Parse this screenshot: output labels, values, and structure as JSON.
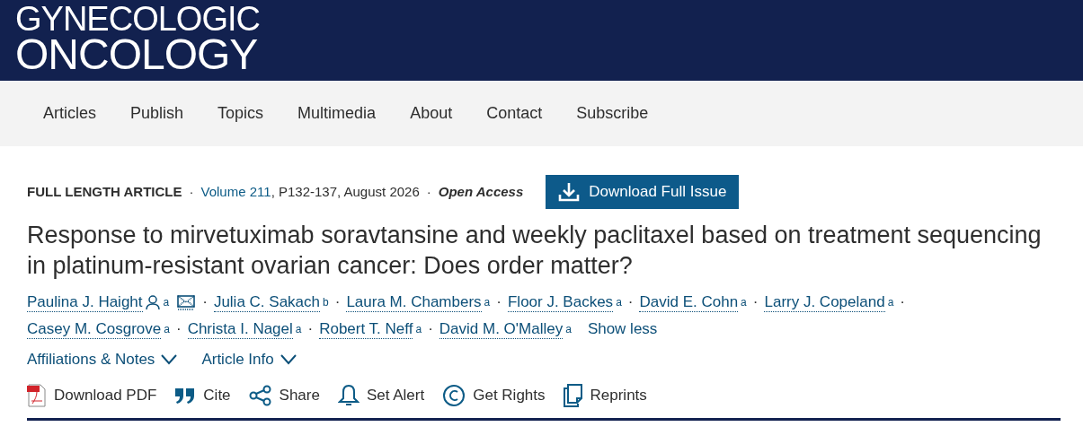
{
  "header": {
    "logo": [
      "GYNECOLOGIC",
      "ONCOLOGY"
    ]
  },
  "nav": [
    "Articles",
    "Publish",
    "Topics",
    "Multimedia",
    "About",
    "Contact",
    "Subscribe"
  ],
  "article": {
    "type": "FULL LENGTH ARTICLE",
    "separators": [
      "·",
      "·"
    ],
    "volume": "Volume 211",
    "citation": ", P132-137, August 2026",
    "access": "Open Access",
    "download_button": "Download Full Issue",
    "title": "Response to mirvetuximab soravtansine and weekly paclitaxel based on treatment sequencing in platinum-resistant ovarian cancer: Does order matter?",
    "authors": [
      {
        "name": "Paulina J. Haight",
        "affiliation": "a",
        "corresponding": true,
        "separator": "·"
      },
      {
        "name": "Julia C. Sakach",
        "affiliation": "b",
        "corresponding": false,
        "separator": "·"
      },
      {
        "name": "Laura M. Chambers",
        "affiliation": "a",
        "corresponding": false,
        "separator": "·"
      },
      {
        "name": "Floor J. Backes",
        "affiliation": "a",
        "corresponding": false,
        "separator": "·"
      },
      {
        "name": "David E. Cohn",
        "affiliation": "a",
        "corresponding": false,
        "separator": "·"
      },
      {
        "name": "Larry J. Copeland",
        "affiliation": "a",
        "corresponding": false,
        "separator": "·"
      },
      {
        "name": "Casey M. Cosgrove",
        "affiliation": "a",
        "corresponding": false,
        "separator": "·"
      },
      {
        "name": "Christa I. Nagel",
        "affiliation": "a",
        "corresponding": false,
        "separator": "·"
      },
      {
        "name": "Robert T. Neff",
        "affiliation": "a",
        "corresponding": false,
        "separator": "·"
      },
      {
        "name": "David M. O'Malley",
        "affiliation": "a",
        "corresponding": false
      }
    ],
    "show_less": "Show less",
    "expanders": [
      {
        "label": "Affiliations & Notes",
        "expanded": false
      },
      {
        "label": "Article Info",
        "expanded": false
      }
    ],
    "actions": [
      {
        "kind": "pdf",
        "label": "Download PDF"
      },
      {
        "kind": "cite",
        "label": "Cite"
      },
      {
        "kind": "share",
        "label": "Share"
      },
      {
        "kind": "alert",
        "label": "Set Alert"
      },
      {
        "kind": "rights",
        "label": "Get Rights"
      },
      {
        "kind": "reprints",
        "label": "Reprints"
      }
    ]
  }
}
